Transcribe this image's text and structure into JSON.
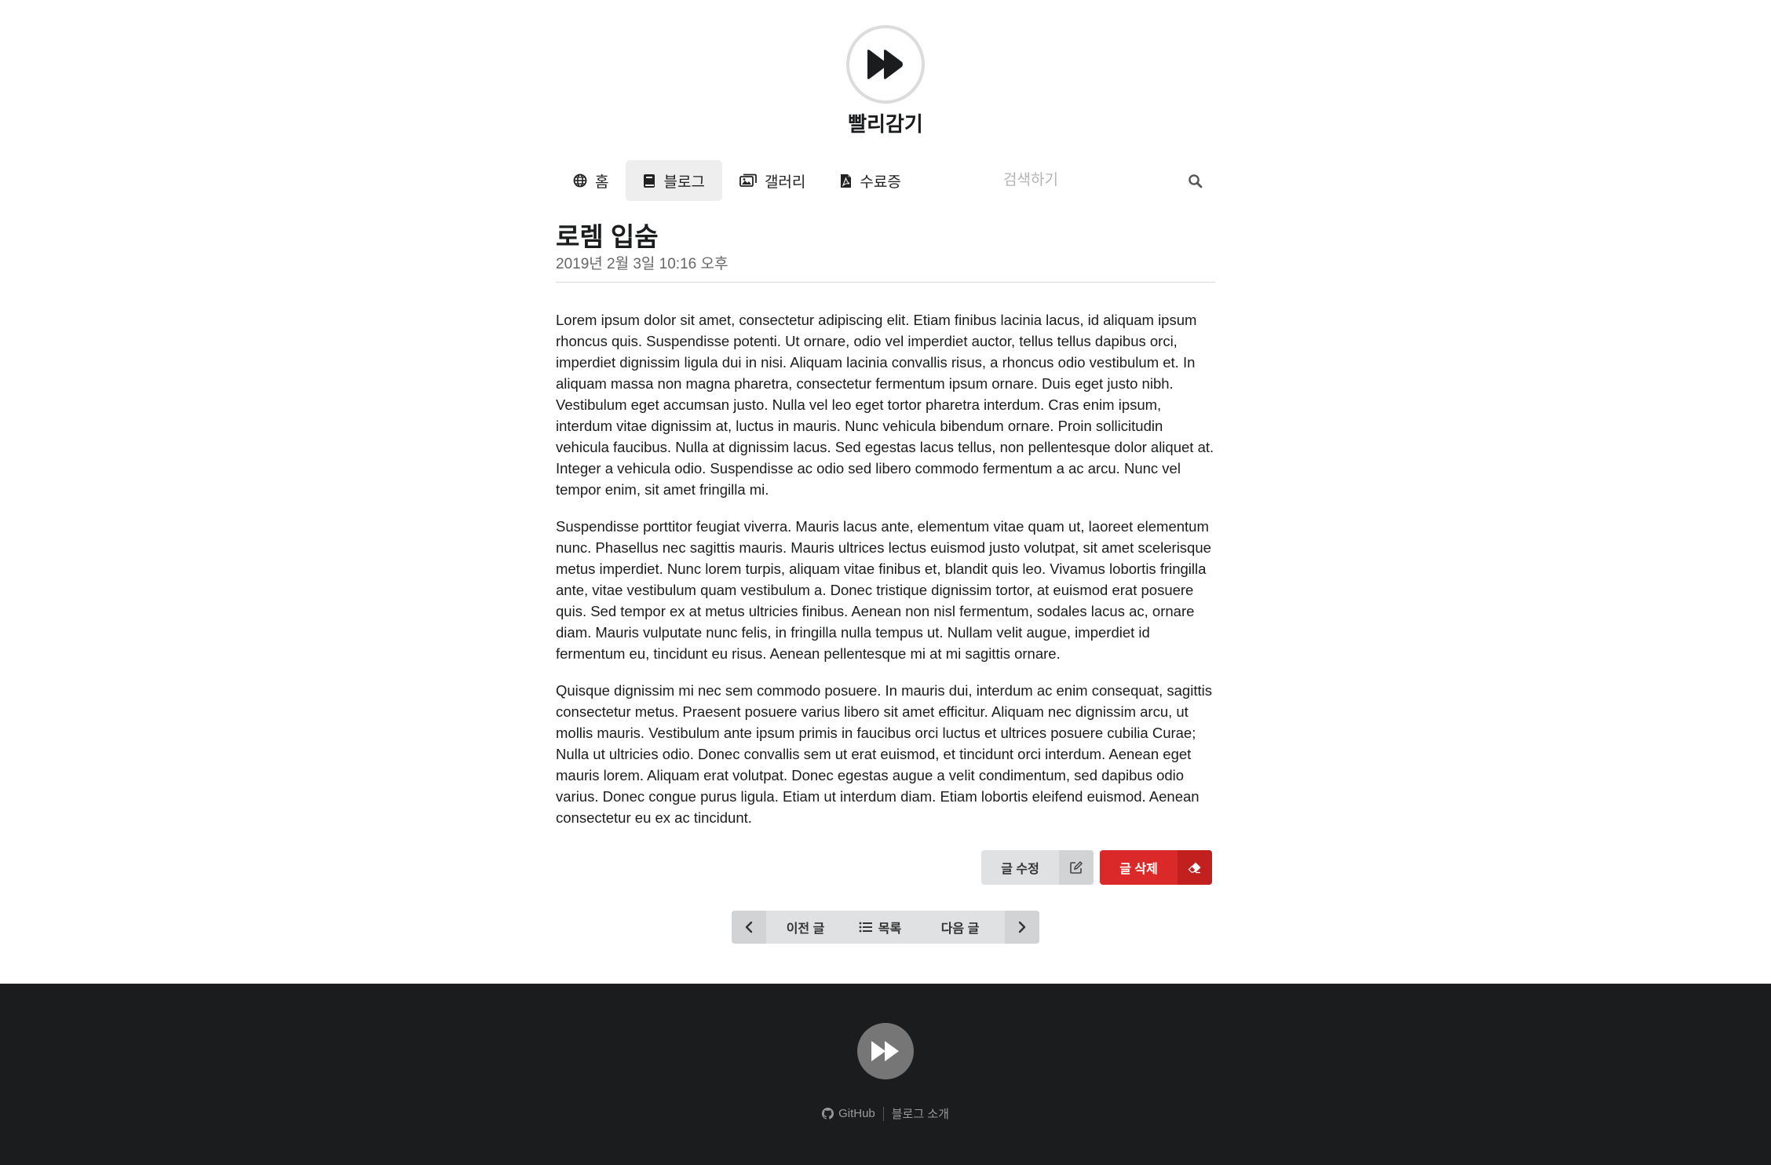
{
  "site": {
    "title": "빨리감기",
    "logo_icon": "fast-forward-icon"
  },
  "nav": {
    "items": [
      {
        "label": "홈",
        "icon": "globe-icon"
      },
      {
        "label": "블로그",
        "icon": "book-icon",
        "active": true
      },
      {
        "label": "갤러리",
        "icon": "images-icon"
      },
      {
        "label": "수료증",
        "icon": "pdf-file-icon"
      }
    ],
    "search_placeholder": "검색하기"
  },
  "post": {
    "title": "로렘 입숨",
    "date": "2019년 2월 3일 10:16 오후",
    "paragraphs": [
      "Lorem ipsum dolor sit amet, consectetur adipiscing elit. Etiam finibus lacinia lacus, id aliquam ipsum rhoncus quis. Suspendisse potenti. Ut ornare, odio vel imperdiet auctor, tellus tellus dapibus orci, imperdiet dignissim ligula dui in nisi. Aliquam lacinia convallis risus, a rhoncus odio vestibulum et. In aliquam massa non magna pharetra, consectetur fermentum ipsum ornare. Duis eget justo nibh. Vestibulum eget accumsan justo. Nulla vel leo eget tortor pharetra interdum. Cras enim ipsum, interdum vitae dignissim at, luctus in mauris. Nunc vehicula bibendum ornare. Proin sollicitudin vehicula faucibus. Nulla at dignissim lacus. Sed egestas lacus tellus, non pellentesque dolor aliquet at. Integer a vehicula odio. Suspendisse ac odio sed libero commodo fermentum a ac arcu. Nunc vel tempor enim, sit amet fringilla mi.",
      "Suspendisse porttitor feugiat viverra. Mauris lacus ante, elementum vitae quam ut, laoreet elementum nunc. Phasellus nec sagittis mauris. Mauris ultrices lectus euismod justo volutpat, sit amet scelerisque metus imperdiet. Nunc lorem turpis, aliquam vitae finibus et, blandit quis leo. Vivamus lobortis fringilla ante, vitae vestibulum quam vestibulum a. Donec tristique dignissim tortor, at euismod erat posuere quis. Sed tempor ex at metus ultricies finibus. Aenean non nisl fermentum, sodales lacus ac, ornare diam. Mauris vulputate nunc felis, in fringilla nulla tempus ut. Nullam velit augue, imperdiet id fermentum eu, tincidunt eu risus. Aenean pellentesque mi at mi sagittis ornare.",
      "Quisque dignissim mi nec sem commodo posuere. In mauris dui, interdum ac enim consequat, sagittis consectetur metus. Praesent posuere varius libero sit amet efficitur. Aliquam nec dignissim arcu, ut mollis mauris. Vestibulum ante ipsum primis in faucibus orci luctus et ultrices posuere cubilia Curae; Nulla ut ultricies odio. Donec convallis sem ut erat euismod, et tincidunt orci interdum. Aenean eget mauris lorem. Aliquam erat volutpat. Donec egestas augue a velit condimentum, sed dapibus odio varius. Donec congue purus ligula. Etiam ut interdum diam. Etiam lobortis eleifend euismod. Aenean consectetur eu ex ac tincidunt."
    ]
  },
  "actions": {
    "edit_label": "글 수정",
    "delete_label": "글 삭제",
    "delete_color": "#db2828"
  },
  "pager": {
    "prev_label": "이전 글",
    "list_label": "목록",
    "next_label": "다음 글"
  },
  "footer": {
    "github_label": "GitHub",
    "about_label": "블로그 소개",
    "background": "#1b1c1d"
  }
}
